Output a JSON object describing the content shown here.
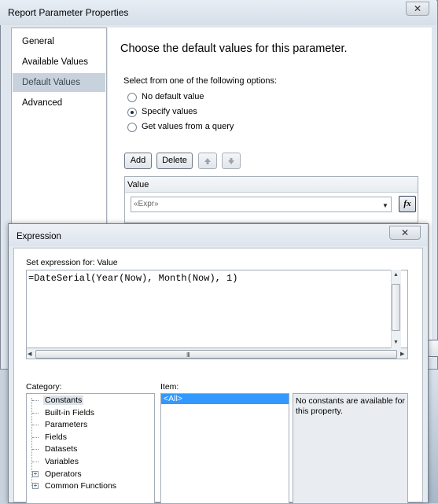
{
  "report_parameter_dialog": {
    "title": "Report Parameter Properties",
    "close_glyph": "✕",
    "nav_items": [
      "General",
      "Available Values",
      "Default Values",
      "Advanced"
    ],
    "heading": "Choose the default values for this parameter.",
    "options_prompt": "Select from one of the following options:",
    "radio_options": [
      "No default value",
      "Specify values",
      "Get values from a query"
    ],
    "selected_option": "Specify values",
    "add_label": "Add",
    "delete_label": "Delete",
    "value_column_header": "Value",
    "value_cell": "«Expr»",
    "fx_label": "fx"
  },
  "expression_dialog": {
    "title": "Expression",
    "close_glyph": "✕",
    "set_expression_label": "Set expression for: Value",
    "expression_text": "=DateSerial(Year(Now), Month(Now), 1)",
    "hscroll_grip": "III",
    "category_label": "Category:",
    "categories": [
      "Constants",
      "Built-in Fields",
      "Parameters",
      "Fields",
      "Datasets",
      "Variables",
      "Operators",
      "Common Functions"
    ],
    "selected_category": "Constants",
    "item_label": "Item:",
    "items": [
      "<All>"
    ],
    "description": "No constants are available for this property."
  },
  "icons": {
    "move_up": "arrow-up-icon",
    "move_down": "arrow-down-icon",
    "expander": "plus-box-icon"
  }
}
